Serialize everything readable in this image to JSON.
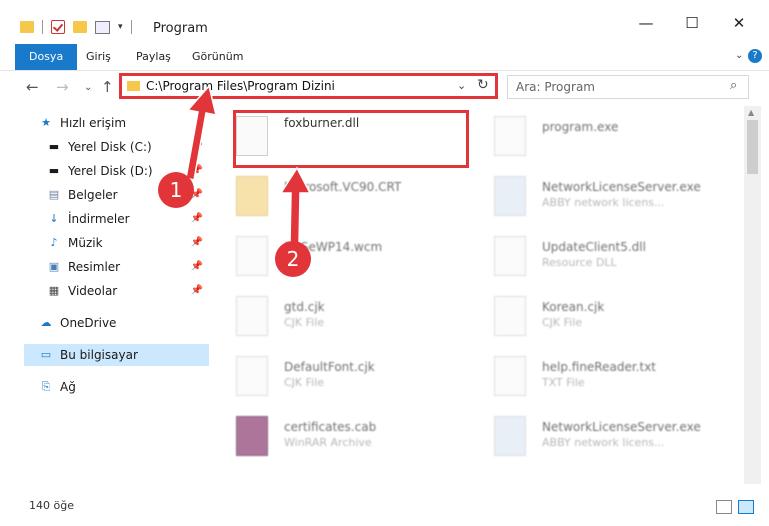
{
  "window": {
    "title": "Program",
    "controls": [
      "—",
      "☐",
      "✕"
    ]
  },
  "ribbon": {
    "tabs": [
      "Dosya",
      "Giriş",
      "Paylaş",
      "Görünüm"
    ]
  },
  "navigation": {
    "address_path": "C:\\Program Files\\Program Dizini",
    "search_placeholder": "Ara: Program"
  },
  "sidebar": {
    "items": [
      {
        "label": "Hızlı erişim",
        "icon": "star-icon"
      },
      {
        "label": "Yerel Disk (C:)",
        "icon": "drive-icon",
        "pinned": true
      },
      {
        "label": "Yerel Disk (D:)",
        "icon": "drive-icon",
        "pinned": true
      },
      {
        "label": "Belgeler",
        "icon": "documents-icon",
        "pinned": true
      },
      {
        "label": "İndirmeler",
        "icon": "download-icon",
        "pinned": true
      },
      {
        "label": "Müzik",
        "icon": "music-icon",
        "pinned": true
      },
      {
        "label": "Resimler",
        "icon": "pictures-icon",
        "pinned": true
      },
      {
        "label": "Videolar",
        "icon": "videos-icon",
        "pinned": true
      },
      {
        "label": "OneDrive",
        "icon": "cloud-icon"
      },
      {
        "label": "Bu bilgisayar",
        "icon": "computer-icon",
        "selected": true
      },
      {
        "label": "Ağ",
        "icon": "network-icon"
      }
    ]
  },
  "files": [
    {
      "name": "foxburner.dll",
      "type": "",
      "highlighted": true
    },
    {
      "name": "program.exe",
      "type": ""
    },
    {
      "name": "Microsoft.VC90.CRT",
      "type": ""
    },
    {
      "name": "NetworkLicenseServer.exe",
      "type": "ABBY network licens..."
    },
    {
      "name": "2DSeWP14.wcm",
      "type": "File"
    },
    {
      "name": "UpdateClient5.dll",
      "type": "Resource DLL"
    },
    {
      "name": "gtd.cjk",
      "type": "CJK File"
    },
    {
      "name": "Korean.cjk",
      "type": "CJK File"
    },
    {
      "name": "DefaultFont.cjk",
      "type": "CJK File"
    },
    {
      "name": "help.fineReader.txt",
      "type": "TXT File"
    },
    {
      "name": "certificates.cab",
      "type": "WinRAR Archive"
    },
    {
      "name": "NetworkLicenseServer.exe",
      "type": "ABBY network licens..."
    }
  ],
  "status": {
    "item_count": "140 öğe"
  },
  "annotations": {
    "marker1": "1",
    "marker2": "2"
  },
  "colors": {
    "accent": "#1979ca",
    "highlight": "#e2353a",
    "selected": "#cce8ff"
  }
}
